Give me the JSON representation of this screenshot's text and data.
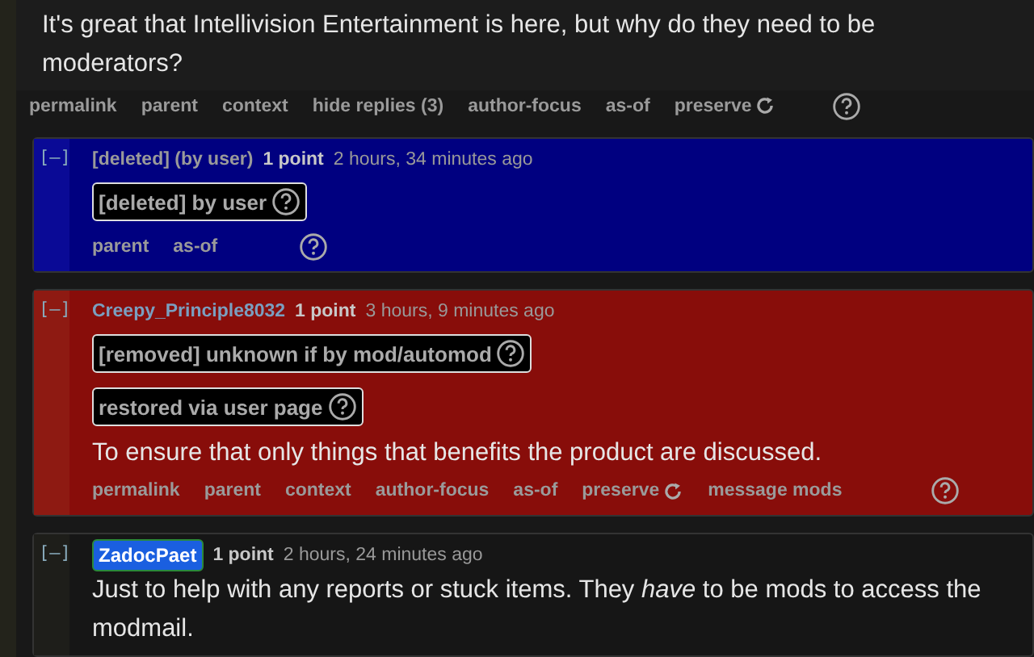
{
  "parent_comment": {
    "body": "It's great that Intellivision Entertainment is here, but why do they need to be moderators?",
    "actions": [
      {
        "label": "permalink"
      },
      {
        "label": "parent"
      },
      {
        "label": "context"
      },
      {
        "label": "hide replies (3)"
      },
      {
        "label": "author-focus"
      },
      {
        "label": "as-of"
      },
      {
        "label": "preserve",
        "kind": "refresh"
      }
    ]
  },
  "comments": [
    {
      "kind": "deleted",
      "collapse": "[–]",
      "author": {
        "name": "[deleted] (by user)",
        "kind": "plain"
      },
      "points": "1 point",
      "time": "2 hours, 34 minutes ago",
      "tags": [
        "[deleted] by user"
      ],
      "actions": [
        {
          "label": "parent"
        },
        {
          "label": "as-of"
        }
      ]
    },
    {
      "kind": "removed",
      "collapse": "[–]",
      "author": {
        "name": "Creepy_Principle8032",
        "kind": "link"
      },
      "points": "1 point",
      "time": "3 hours, 9 minutes ago",
      "tags": [
        "[removed] unknown if by mod/automod",
        "restored via user page"
      ],
      "body": "To ensure that only things that benefits the product are discussed.",
      "actions": [
        {
          "label": "permalink"
        },
        {
          "label": "parent"
        },
        {
          "label": "context"
        },
        {
          "label": "author-focus"
        },
        {
          "label": "as-of"
        },
        {
          "label": "preserve",
          "kind": "refresh"
        },
        {
          "label": "message mods"
        }
      ]
    },
    {
      "kind": "normal",
      "collapse": "[–]",
      "author": {
        "name": "ZadocPaet",
        "kind": "badge"
      },
      "points": "1 point",
      "time": "2 hours, 24 minutes ago",
      "body": "Just to help with any reports or stuck items. They *have* to be mods to access the modmail."
    }
  ]
}
